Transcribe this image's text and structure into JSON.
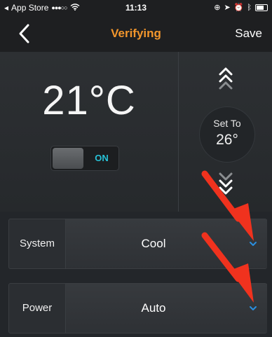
{
  "status_bar": {
    "carrier": "App Store",
    "signal": "●●●○○",
    "time": "11:13"
  },
  "nav": {
    "title": "Verifying",
    "save_label": "Save"
  },
  "thermostat": {
    "current_temp": "21°C",
    "toggle_label": "ON",
    "setpoint_label": "Set To",
    "setpoint_value": "26°"
  },
  "settings": {
    "system_label": "System",
    "system_value": "Cool",
    "power_label": "Power",
    "power_value": "Auto"
  },
  "colors": {
    "title_accent": "#f2962c",
    "toggle_on": "#27c3d8",
    "chevron": "#2a8fe0",
    "annotation_arrow": "#f0321e"
  }
}
